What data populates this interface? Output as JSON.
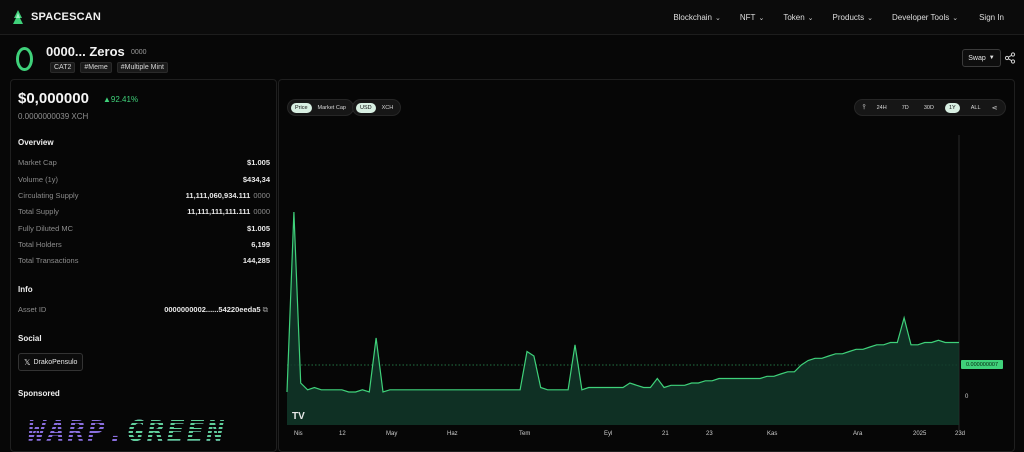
{
  "brand": {
    "name": "SPACESCAN"
  },
  "nav": {
    "items": [
      {
        "label": "Blockchain"
      },
      {
        "label": "NFT"
      },
      {
        "label": "Token"
      },
      {
        "label": "Products"
      },
      {
        "label": "Developer Tools"
      }
    ],
    "signin": "Sign In"
  },
  "token": {
    "name": "0000... Zeros",
    "symbol": "0000",
    "tags": [
      "CAT2",
      "#Meme",
      "#Multiple Mint"
    ],
    "swap_label": "Swap"
  },
  "price": {
    "usd": "$0,000000",
    "change": "▲92.41%",
    "xch": "0.0000000039",
    "xch_unit": "XCH"
  },
  "overview": {
    "title": "Overview",
    "rows": [
      {
        "label": "Market Cap",
        "value": "$1.005",
        "unit": ""
      },
      {
        "label": "Volume (1y)",
        "value": "$434,34",
        "unit": ""
      },
      {
        "label": "Circulating Supply",
        "value": "11,111,060,934.111",
        "unit": "0000"
      },
      {
        "label": "Total Supply",
        "value": "11,111,111,111.111",
        "unit": "0000"
      },
      {
        "label": "Fully Diluted MC",
        "value": "$1.005",
        "unit": ""
      },
      {
        "label": "Total Holders",
        "value": "6,199",
        "unit": ""
      },
      {
        "label": "Total Transactions",
        "value": "144,285",
        "unit": ""
      }
    ]
  },
  "info": {
    "title": "Info",
    "asset_label": "Asset ID",
    "asset_value": "0000000002......54220eeda5"
  },
  "social": {
    "title": "Social",
    "handle": "DrakoPensulo"
  },
  "sponsored": {
    "title": "Sponsored",
    "banner_a": "WARP.",
    "banner_b": "GREEN"
  },
  "chart_controls": {
    "mode": [
      "Price",
      "Market Cap"
    ],
    "currency": [
      "USD",
      "XCH"
    ],
    "ranges": [
      "24H",
      "7D",
      "30D",
      "1Y",
      "ALL"
    ],
    "active_range": "1Y"
  },
  "chart_data": {
    "type": "area",
    "x_ticks": [
      "Nis",
      "12",
      "May",
      "Haz",
      "Tem",
      "Eyl",
      "21",
      "23",
      "Kas",
      "Ara",
      "2025",
      "23d"
    ],
    "y_ticks": [
      "0"
    ],
    "last_price_label": "0.000000007",
    "series": [
      {
        "values": [
          0.08,
          0.88,
          0.12,
          0.09,
          0.1,
          0.09,
          0.09,
          0.09,
          0.09,
          0.08,
          0.08,
          0.09,
          0.08,
          0.32,
          0.08,
          0.09,
          0.09,
          0.09,
          0.09,
          0.09,
          0.09,
          0.09,
          0.09,
          0.09,
          0.09,
          0.09,
          0.09,
          0.09,
          0.09,
          0.09,
          0.09,
          0.09,
          0.09,
          0.09,
          0.09,
          0.26,
          0.24,
          0.1,
          0.09,
          0.09,
          0.09,
          0.09,
          0.29,
          0.09,
          0.1,
          0.1,
          0.1,
          0.1,
          0.1,
          0.1,
          0.12,
          0.11,
          0.1,
          0.1,
          0.14,
          0.1,
          0.11,
          0.11,
          0.11,
          0.12,
          0.12,
          0.13,
          0.13,
          0.14,
          0.14,
          0.14,
          0.14,
          0.14,
          0.14,
          0.14,
          0.15,
          0.15,
          0.16,
          0.17,
          0.17,
          0.2,
          0.22,
          0.23,
          0.23,
          0.24,
          0.25,
          0.25,
          0.26,
          0.27,
          0.27,
          0.28,
          0.29,
          0.29,
          0.3,
          0.3,
          0.41,
          0.29,
          0.29,
          0.3,
          0.3,
          0.31,
          0.3,
          0.3,
          0.3
        ]
      }
    ],
    "grid": false
  }
}
